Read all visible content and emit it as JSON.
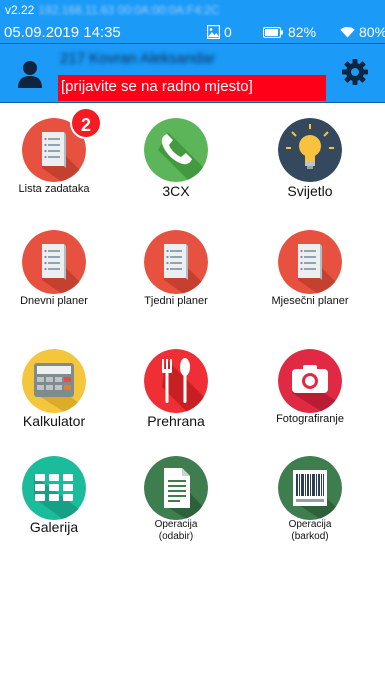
{
  "header": {
    "version": "v2.22",
    "ip": "192.168.11.63 00:0A:00:0A:F4:2C",
    "date_time": "05.09.2019  14:35",
    "messages_count": "0",
    "battery": "82%",
    "wifi": "80%",
    "username": "217 Kovran Aleksandar",
    "notice": "[prijavite se na radno mjesto]",
    "colors": {
      "bar": "#1b9af7",
      "notice": "#ff0019"
    }
  },
  "tiles": [
    {
      "label": "Lista zadataka",
      "icon": "task-list-icon",
      "badge": "2"
    },
    {
      "label": "3CX",
      "icon": "phone-icon"
    },
    {
      "label": "Svijetlo",
      "icon": "light-bulb-icon"
    },
    {
      "label": "Dnevni planer",
      "icon": "task-list-icon"
    },
    {
      "label": "Tjedni planer",
      "icon": "task-list-icon"
    },
    {
      "label": "Mjesečni planer",
      "icon": "task-list-icon"
    },
    {
      "label": "Kalkulator",
      "icon": "calculator-icon"
    },
    {
      "label": "Prehrana",
      "icon": "fork-spoon-icon"
    },
    {
      "label": "Fotografiranje",
      "icon": "camera-icon"
    },
    {
      "label": "Galerija",
      "icon": "gallery-grid-icon"
    },
    {
      "label": "Operacija\n(odabir)",
      "icon": "document-icon"
    },
    {
      "label": "Operacija\n(barkod)",
      "icon": "barcode-icon"
    }
  ]
}
